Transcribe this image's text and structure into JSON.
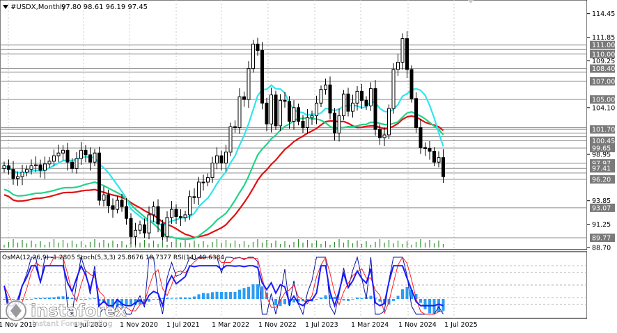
{
  "window": {
    "symbol_title": "#USDX,Monthly",
    "ohlc": "97.80 98.61 96.19 97.45",
    "menu_icon": "triangle-down-icon"
  },
  "colors": {
    "bull": "#000000",
    "bear": "#000000",
    "ma_fast": "#2ee6ee",
    "ma_mid": "#22d38a",
    "ma_slow": "#e01010",
    "hline": "#8c8c8c",
    "label_bg": "#7a7a7a",
    "osma": "#2a9df4",
    "stoch_main": "#0a14a0",
    "stoch_signal": "#ff2020",
    "rsi": "#1a1aff",
    "volume": "#2e8b2e"
  },
  "chart_data": [
    {
      "type": "candlestick",
      "title": "#USDX,Monthly",
      "ylim": [
        88.7,
        115.8
      ],
      "y_ticks": [
        "114.45",
        "111.85",
        "109.25",
        "104.10",
        "98.95",
        "93.85",
        "91.25",
        "88.70"
      ],
      "price_levels": [
        "111.00",
        "110.00",
        "108.40",
        "107.00",
        "105.00",
        "101.70",
        "100.45",
        "99.65",
        "97.97",
        "97.41",
        "96.20",
        "93.07",
        "89.77"
      ],
      "level_values": [
        111.0,
        110.0,
        108.4,
        107.0,
        105.0,
        101.7,
        100.45,
        99.65,
        97.97,
        97.41,
        96.2,
        93.07,
        89.77
      ],
      "extra_hlines": [
        110.5,
        108.0,
        101.9,
        101.3,
        100.9,
        96.9
      ],
      "x_labels": [
        "1 Nov 2019",
        "1 Jul 2020",
        "1 Nov 2020",
        "1 Jul 2021",
        "1 Mar 2022",
        "1 Nov 2022",
        "1 Jul 2023",
        "1 Mar 2024",
        "1 Nov 2024",
        "1 Jul 2025"
      ],
      "candles_close": [
        97.7,
        97.3,
        96.3,
        96.5,
        97.0,
        97.3,
        97.7,
        97.8,
        97.2,
        97.9,
        98.2,
        98.8,
        99.1,
        99.4,
        98.1,
        97.4,
        98.5,
        99.4,
        98.9,
        98.1,
        99.1,
        93.9,
        94.5,
        93.3,
        92.9,
        93.9,
        93.2,
        91.9,
        89.9,
        90.6,
        91.2,
        90.3,
        92.3,
        93.2,
        91.3,
        89.9,
        92.0,
        92.9,
        92.1,
        92.0,
        92.3,
        94.3,
        94.2,
        95.9,
        95.9,
        96.4,
        98.0,
        98.8,
        98.0,
        99.2,
        102.0,
        101.9,
        105.3,
        105.0,
        108.4,
        111.1,
        110.4,
        104.6,
        102.3,
        105.5,
        102.1,
        104.9,
        104.8,
        102.6,
        104.1,
        102.6,
        101.9,
        103.0,
        103.2,
        104.6,
        106.1,
        106.6,
        103.5,
        101.3,
        103.2,
        105.6,
        103.7,
        104.6,
        105.9,
        104.9,
        104.3,
        106.2,
        101.7,
        100.8,
        101.1,
        104.0,
        108.3,
        109.1,
        111.7,
        108.3,
        105.1,
        101.9,
        99.7,
        99.6,
        99.3,
        98.1,
        98.6,
        96.5
      ]
    },
    {
      "type": "histogram_lines",
      "title": "OsMA(12,26,9) -1.2805 Stoch(5,3,3) 25.8676 18.7377 RSI(14) 40.6384",
      "ylim": [
        -1.4475,
        2.2272
      ],
      "y_ticks": [
        "2.2272",
        "-1.4475"
      ],
      "secondary_ticks": [
        "80",
        "70",
        "50",
        "30",
        "20"
      ],
      "secondary_values": [
        80,
        70,
        50,
        30,
        20
      ],
      "osma_last": -1.2805,
      "stoch_main_last": 25.8676,
      "stoch_signal_last": 18.7377,
      "rsi_last": 40.6384
    }
  ],
  "watermark": {
    "brand": "instaforex",
    "tagline": "Instant Forex Trading"
  }
}
